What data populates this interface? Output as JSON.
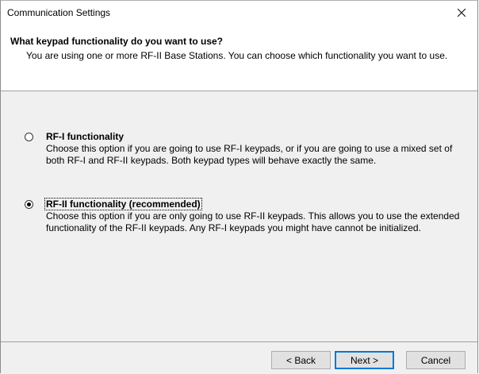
{
  "window": {
    "title": "Communication Settings"
  },
  "header": {
    "title": "What keypad functionality do you want to use?",
    "subtitle": "You are using one or more RF-II Base Stations. You can choose which functionality you want to use."
  },
  "options": [
    {
      "label": "RF-I functionality",
      "description": "Choose this option if you are going to use RF-I keypads, or if you are going to use a mixed set of both RF-I and RF-II keypads. Both keypad types will behave exactly the same.",
      "selected": false
    },
    {
      "label": "RF-II functionality (recommended)",
      "description": "Choose this option if you are only going to use RF-II keypads. This allows you to use the extended functionality of the RF-II keypads. Any RF-I keypads you might have cannot be initialized.",
      "selected": true
    }
  ],
  "footer": {
    "back_label": "< Back",
    "next_label": "Next >",
    "cancel_label": "Cancel"
  },
  "icons": {
    "close": "close-icon"
  },
  "colors": {
    "accent": "#0078d7",
    "panel": "#f0f0f0"
  }
}
